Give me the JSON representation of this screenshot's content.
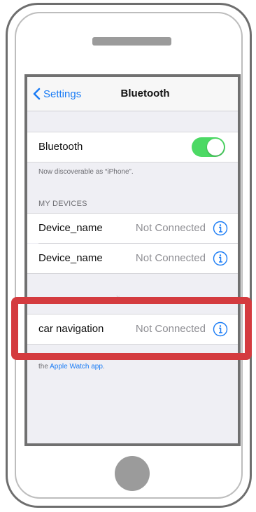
{
  "navbar": {
    "back_label": "Settings",
    "title": "Bluetooth"
  },
  "bluetooth": {
    "label": "Bluetooth",
    "enabled": true,
    "toggle_color": "#4cd964",
    "discoverable_note": "Now discoverable as “iPhone”."
  },
  "my_devices": {
    "header": "MY DEVICES",
    "items": [
      {
        "name": "Device_name",
        "status": "Not Connected"
      },
      {
        "name": "Device_name",
        "status": "Not Connected"
      }
    ]
  },
  "other_device": {
    "name": "car navigation",
    "status": "Not Connected"
  },
  "footer": {
    "prefix": "the ",
    "link": "Apple Watch app",
    "suffix": "."
  },
  "colors": {
    "accent": "#1a7cf5",
    "highlight": "#d43b3f"
  }
}
